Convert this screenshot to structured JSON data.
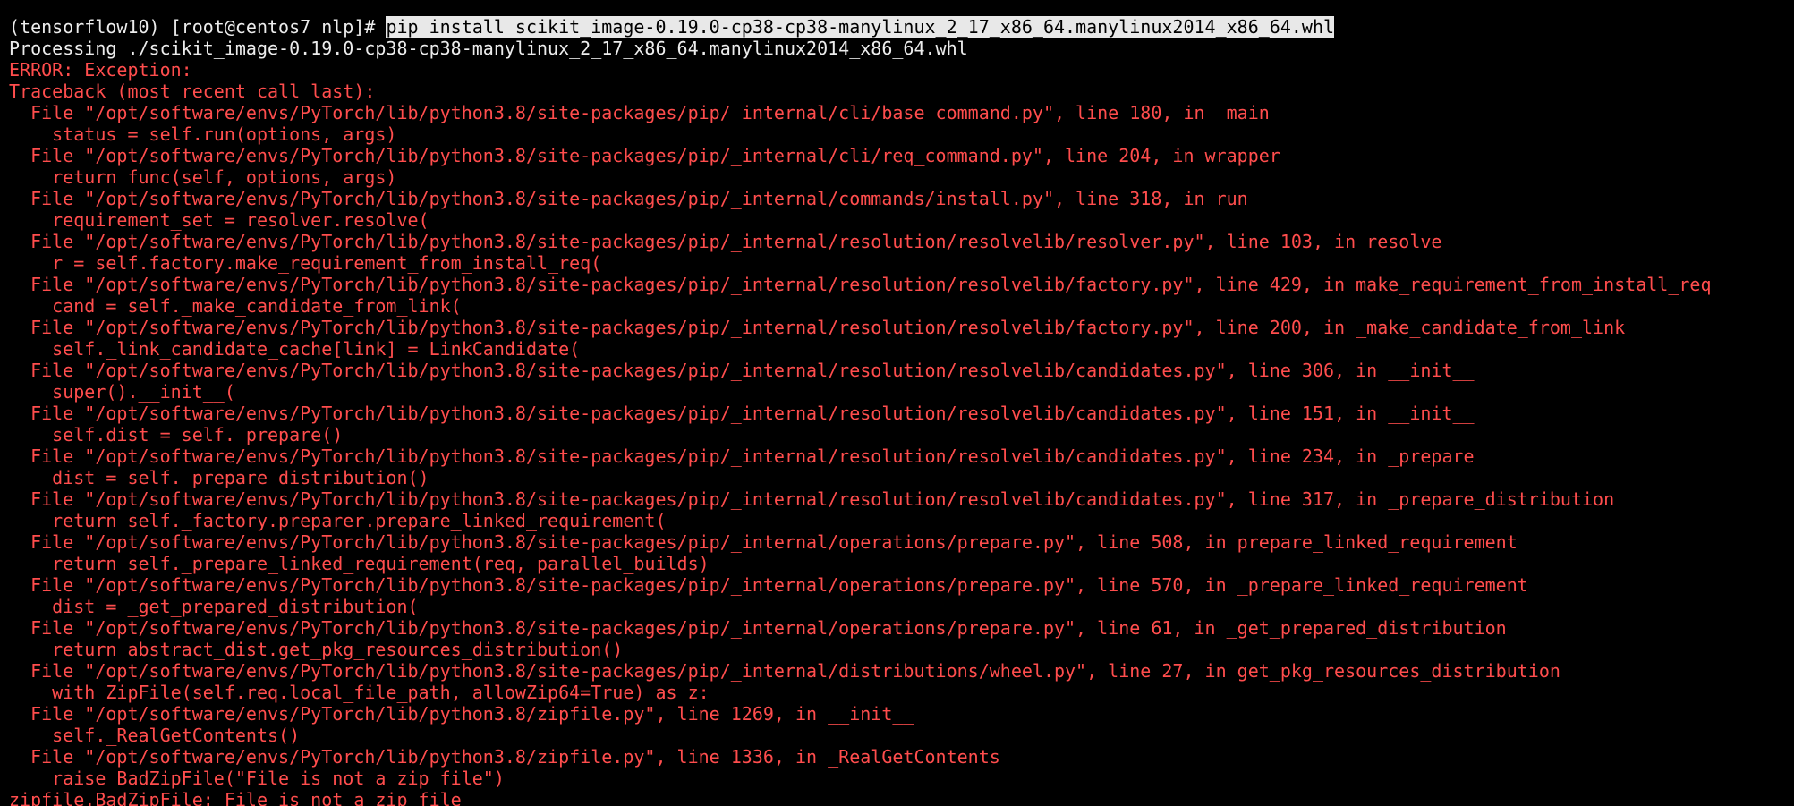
{
  "terminal": {
    "prompt": "(tensorflow10) [root@centos7 nlp]# ",
    "command": "pip install scikit_image-0.19.0-cp38-cp38-manylinux_2_17_x86_64.manylinux2014_x86_64.whl",
    "processing": "Processing ./scikit_image-0.19.0-cp38-cp38-manylinux_2_17_x86_64.manylinux2014_x86_64.whl",
    "error_header": "ERROR: Exception:",
    "traceback_header": "Traceback (most recent call last):",
    "traceback": [
      "  File \"/opt/software/envs/PyTorch/lib/python3.8/site-packages/pip/_internal/cli/base_command.py\", line 180, in _main",
      "    status = self.run(options, args)",
      "  File \"/opt/software/envs/PyTorch/lib/python3.8/site-packages/pip/_internal/cli/req_command.py\", line 204, in wrapper",
      "    return func(self, options, args)",
      "  File \"/opt/software/envs/PyTorch/lib/python3.8/site-packages/pip/_internal/commands/install.py\", line 318, in run",
      "    requirement_set = resolver.resolve(",
      "  File \"/opt/software/envs/PyTorch/lib/python3.8/site-packages/pip/_internal/resolution/resolvelib/resolver.py\", line 103, in resolve",
      "    r = self.factory.make_requirement_from_install_req(",
      "  File \"/opt/software/envs/PyTorch/lib/python3.8/site-packages/pip/_internal/resolution/resolvelib/factory.py\", line 429, in make_requirement_from_install_req",
      "    cand = self._make_candidate_from_link(",
      "  File \"/opt/software/envs/PyTorch/lib/python3.8/site-packages/pip/_internal/resolution/resolvelib/factory.py\", line 200, in _make_candidate_from_link",
      "    self._link_candidate_cache[link] = LinkCandidate(",
      "  File \"/opt/software/envs/PyTorch/lib/python3.8/site-packages/pip/_internal/resolution/resolvelib/candidates.py\", line 306, in __init__",
      "    super().__init__(",
      "  File \"/opt/software/envs/PyTorch/lib/python3.8/site-packages/pip/_internal/resolution/resolvelib/candidates.py\", line 151, in __init__",
      "    self.dist = self._prepare()",
      "  File \"/opt/software/envs/PyTorch/lib/python3.8/site-packages/pip/_internal/resolution/resolvelib/candidates.py\", line 234, in _prepare",
      "    dist = self._prepare_distribution()",
      "  File \"/opt/software/envs/PyTorch/lib/python3.8/site-packages/pip/_internal/resolution/resolvelib/candidates.py\", line 317, in _prepare_distribution",
      "    return self._factory.preparer.prepare_linked_requirement(",
      "  File \"/opt/software/envs/PyTorch/lib/python3.8/site-packages/pip/_internal/operations/prepare.py\", line 508, in prepare_linked_requirement",
      "    return self._prepare_linked_requirement(req, parallel_builds)",
      "  File \"/opt/software/envs/PyTorch/lib/python3.8/site-packages/pip/_internal/operations/prepare.py\", line 570, in _prepare_linked_requirement",
      "    dist = _get_prepared_distribution(",
      "  File \"/opt/software/envs/PyTorch/lib/python3.8/site-packages/pip/_internal/operations/prepare.py\", line 61, in _get_prepared_distribution",
      "    return abstract_dist.get_pkg_resources_distribution()",
      "  File \"/opt/software/envs/PyTorch/lib/python3.8/site-packages/pip/_internal/distributions/wheel.py\", line 27, in get_pkg_resources_distribution",
      "    with ZipFile(self.req.local_file_path, allowZip64=True) as z:",
      "  File \"/opt/software/envs/PyTorch/lib/python3.8/zipfile.py\", line 1269, in __init__",
      "    self._RealGetContents()",
      "  File \"/opt/software/envs/PyTorch/lib/python3.8/zipfile.py\", line 1336, in _RealGetContents",
      "    raise BadZipFile(\"File is not a zip file\")"
    ],
    "final_error": "zipfile.BadZipFile: File is not a zip file"
  },
  "colors": {
    "background": "#000000",
    "text_white": "#ececec",
    "text_red": "#ff4d4d",
    "command_highlight_bg": "#e8e8e8"
  }
}
